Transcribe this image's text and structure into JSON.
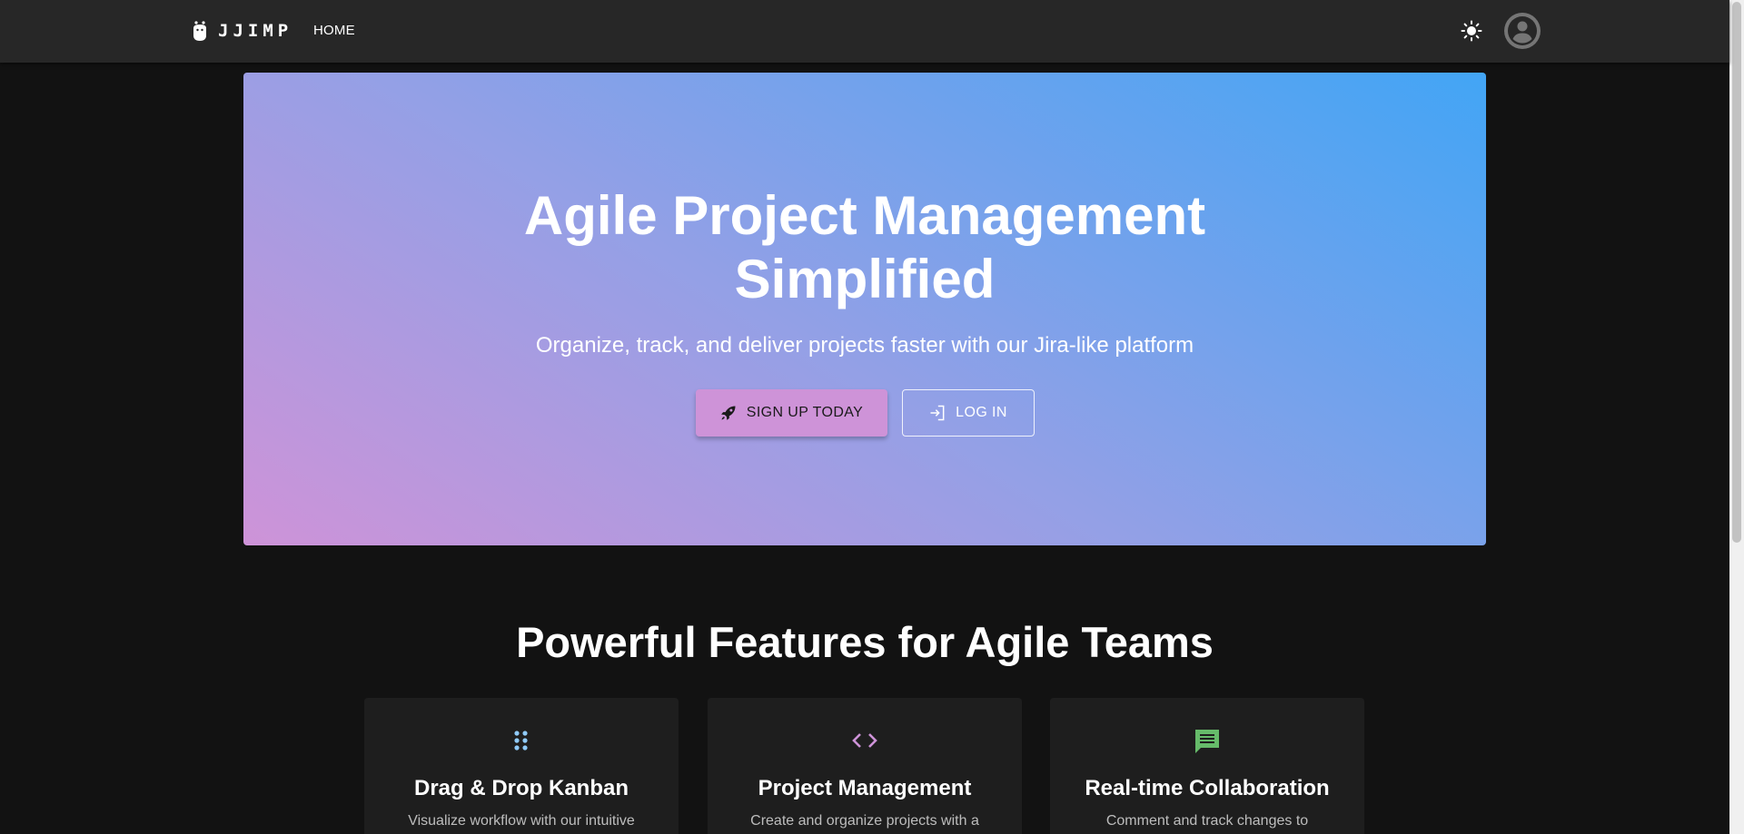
{
  "app": {
    "brand_name": "JJIMP"
  },
  "nav": {
    "home_label": "HOME"
  },
  "header_icons": {
    "theme_toggle": "sun-icon",
    "account": "account-circle-icon"
  },
  "hero": {
    "title": "Agile Project Management Simplified",
    "subtitle": "Organize, track, and deliver projects faster with our Jira-like platform",
    "signup_label": "SIGN UP TODAY",
    "login_label": "LOG IN",
    "gradient_colors": [
      "#ce93d8",
      "#42a5f5"
    ]
  },
  "features": {
    "title": "Powerful Features for Agile Teams",
    "items": [
      {
        "icon": "drag-indicator-icon",
        "icon_color": "#90caf9",
        "title": "Drag & Drop Kanban",
        "description": "Visualize workflow with our intuitive"
      },
      {
        "icon": "code-icon",
        "icon_color": "#ce93d8",
        "title": "Project Management",
        "description": "Create and organize projects with a"
      },
      {
        "icon": "chat-icon",
        "icon_color": "#66bb6a",
        "title": "Real-time Collaboration",
        "description": "Comment and track changes to"
      }
    ]
  },
  "colors": {
    "background": "#121212",
    "appbar": "#272727",
    "card": "#1e1e1e",
    "primary": "#ce93d8"
  }
}
